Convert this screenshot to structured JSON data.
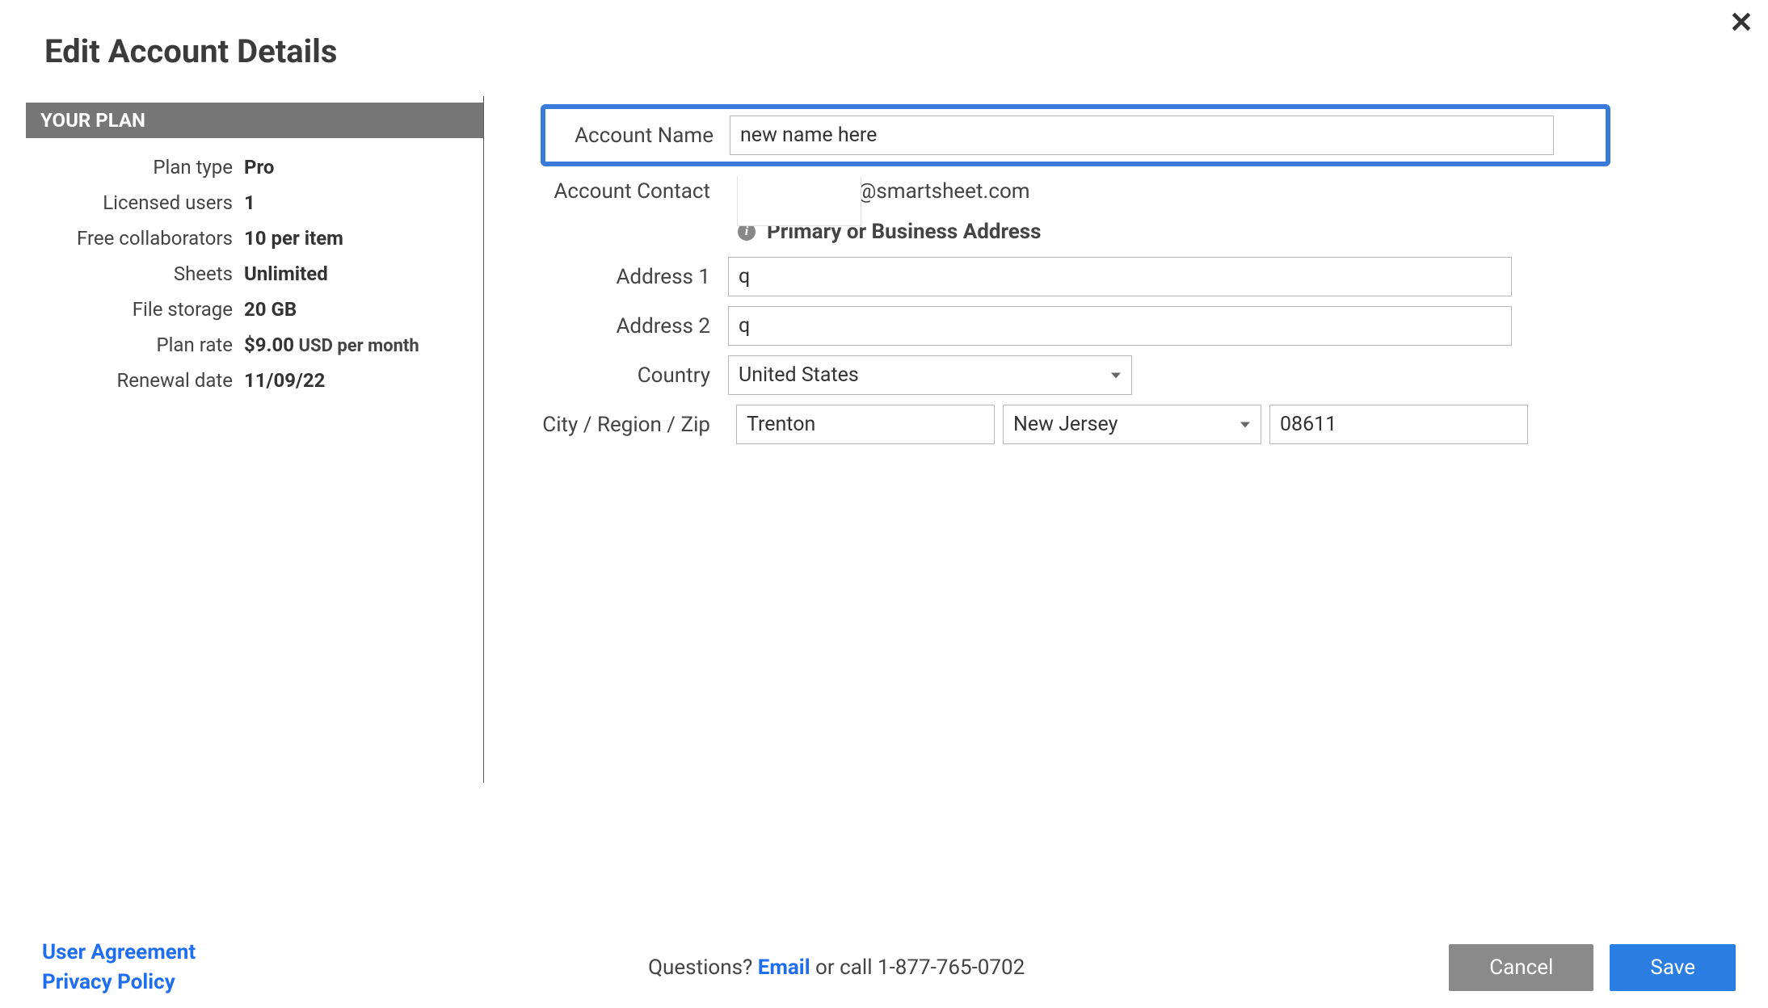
{
  "page_title": "Edit Account Details",
  "close_glyph": "✕",
  "sidebar": {
    "header": "YOUR PLAN",
    "rows": {
      "plan_type": {
        "label": "Plan type",
        "value": "Pro"
      },
      "licensed_users": {
        "label": "Licensed users",
        "value": "1"
      },
      "free_collab": {
        "label": "Free collaborators",
        "value": "10 per item"
      },
      "sheets": {
        "label": "Sheets",
        "value": "Unlimited"
      },
      "file_storage": {
        "label": "File storage",
        "value": "20 GB"
      },
      "plan_rate": {
        "label": "Plan rate",
        "value": "$9.00",
        "sub": " USD per month"
      },
      "renewal": {
        "label": "Renewal date",
        "value": "11/09/22"
      }
    }
  },
  "form": {
    "account_name": {
      "label": "Account Name",
      "value": "new name here"
    },
    "account_contact": {
      "label": "Account Contact",
      "value_suffix": "@smartsheet.com"
    },
    "address_section": {
      "title": "Primary or Business Address"
    },
    "address1": {
      "label": "Address 1",
      "value": "q"
    },
    "address2": {
      "label": "Address 2",
      "value": "q"
    },
    "country": {
      "label": "Country",
      "value": "United States"
    },
    "city_region_zip": {
      "label": "City / Region / Zip",
      "city": "Trenton",
      "region": "New Jersey",
      "zip": "08611"
    }
  },
  "footer": {
    "user_agreement": "User Agreement",
    "privacy_policy": "Privacy Policy",
    "questions_prefix": "Questions? ",
    "email_label": "Email",
    "questions_suffix": " or call 1-877-765-0702",
    "cancel": "Cancel",
    "save": "Save"
  }
}
